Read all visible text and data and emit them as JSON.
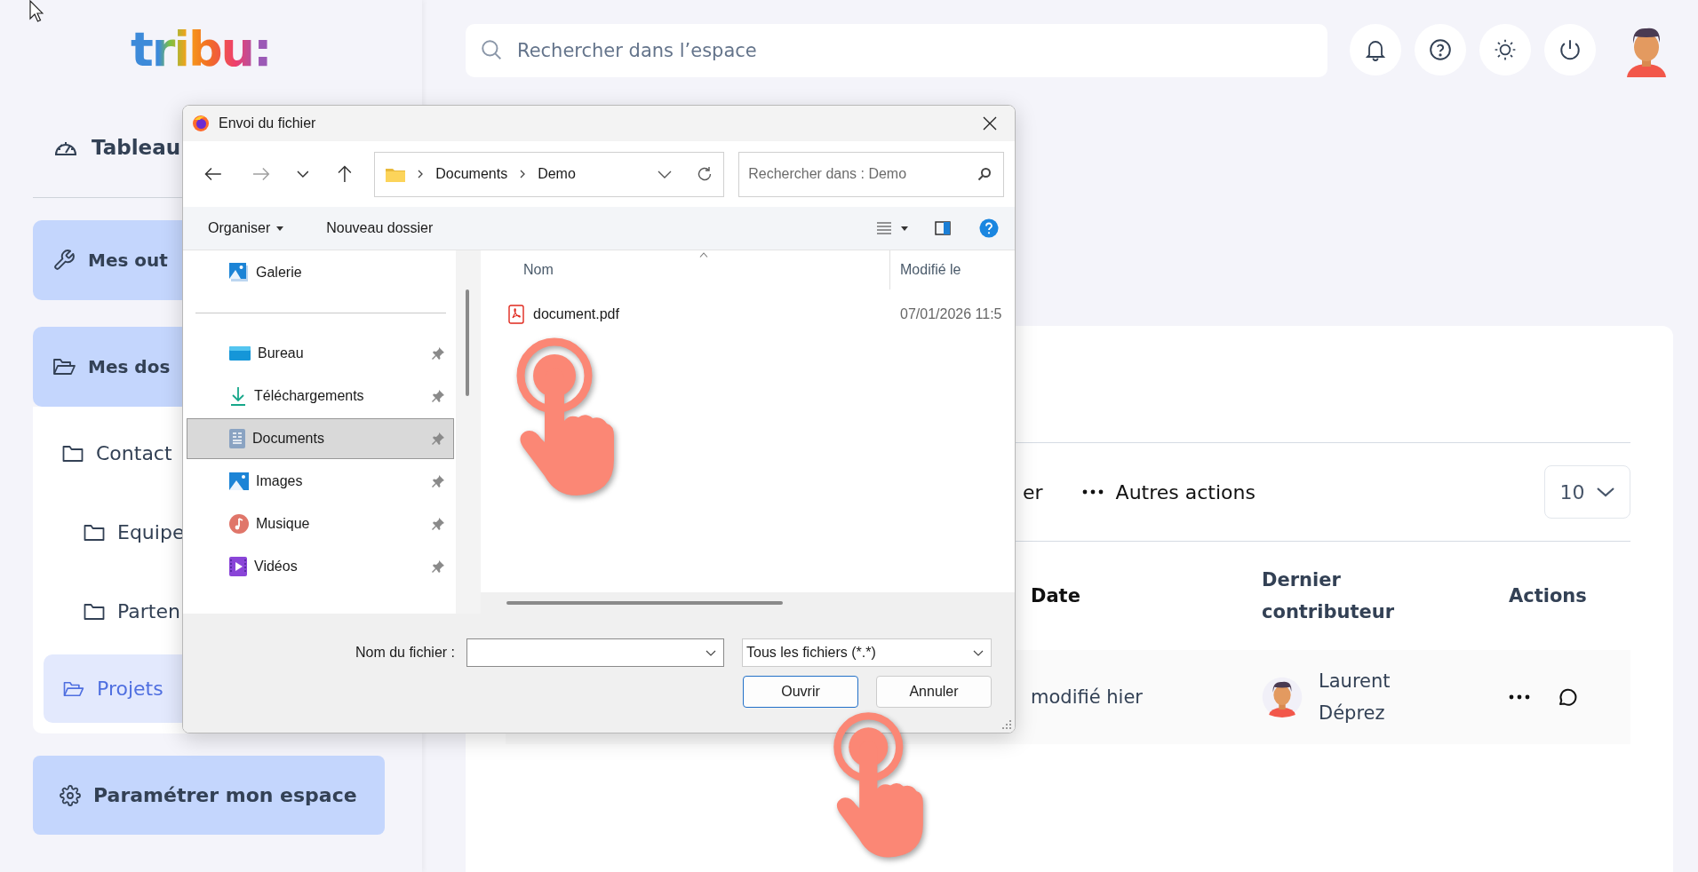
{
  "sidebar": {
    "logo": "tribu:",
    "nav": [
      {
        "label": "Tableau",
        "kind": "plain"
      },
      {
        "label": "Mes out",
        "kind": "card"
      },
      {
        "label": "Mes dos",
        "kind": "card"
      }
    ],
    "folders": [
      {
        "label": "Contact",
        "selected": false,
        "children": [
          {
            "label": "Equipe",
            "selected": false
          },
          {
            "label": "Parten",
            "selected": false
          }
        ]
      },
      {
        "label": "Projets",
        "selected": true
      }
    ],
    "settings_button": "Paramétrer mon espace"
  },
  "header": {
    "search": {
      "placeholder": "Rechercher dans l’espace"
    }
  },
  "table": {
    "toolbar": [
      "er",
      "Autres actions"
    ],
    "page_size": "10",
    "columns": [
      "Date",
      "Dernier contributeur",
      "Actions"
    ],
    "rows": [
      {
        "date": "modifié hier",
        "contributor": "Laurent Déprez"
      }
    ]
  },
  "dialog": {
    "title": "Envoi du fichier",
    "nav_buttons": [
      {
        "kind": "back",
        "disabled": false
      },
      {
        "kind": "forward",
        "disabled": true
      },
      {
        "kind": "recent",
        "disabled": false
      },
      {
        "kind": "up",
        "disabled": false
      }
    ],
    "path": [
      "Documents",
      "Demo"
    ],
    "search": {
      "placeholder": "Rechercher dans : Demo"
    },
    "toolbar": [
      "Organiser",
      "Nouveau dossier"
    ],
    "places": [
      {
        "label": "Galerie",
        "kind": "gallery",
        "selected": false,
        "pinned": false
      },
      {
        "label": "Bureau",
        "kind": "desktop",
        "selected": false,
        "pinned": true
      },
      {
        "label": "Téléchargements",
        "kind": "downloads",
        "selected": false,
        "pinned": true
      },
      {
        "label": "Documents",
        "kind": "documents",
        "selected": true,
        "pinned": true
      },
      {
        "label": "Images",
        "kind": "pictures",
        "selected": false,
        "pinned": true
      },
      {
        "label": "Musique",
        "kind": "music",
        "selected": false,
        "pinned": true
      },
      {
        "label": "Vidéos",
        "kind": "videos",
        "selected": false,
        "pinned": true
      }
    ],
    "columns": [
      "Nom",
      "Modifié le"
    ],
    "files": [
      {
        "name": "document.pdf",
        "modified": "07/01/2026 11:5"
      }
    ],
    "filename_label": "Nom du fichier :",
    "filter": "Tous les fichiers (*.*)",
    "buttons": [
      {
        "label": "Ouvrir",
        "default": true
      },
      {
        "label": "Annuler",
        "default": false
      }
    ]
  }
}
